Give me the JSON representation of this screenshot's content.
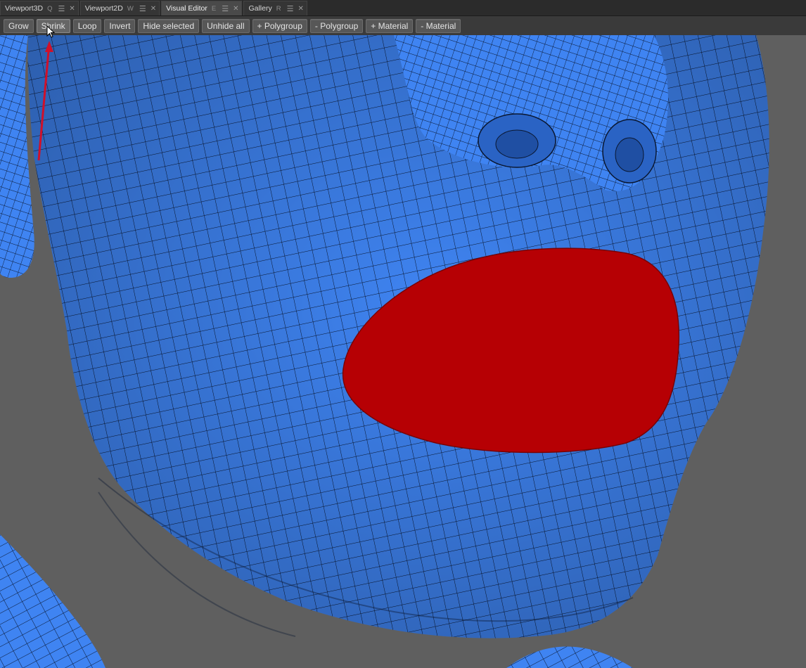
{
  "tabs": [
    {
      "label": "Viewport3D",
      "key": "Q"
    },
    {
      "label": "Viewport2D",
      "key": "W"
    },
    {
      "label": "Visual Editor",
      "key": "E"
    },
    {
      "label": "Gallery",
      "key": "R"
    }
  ],
  "toolbar": {
    "buttons": [
      "Grow",
      "Shrink",
      "Loop",
      "Invert",
      "Hide selected",
      "Unhide all",
      "+ Polygroup",
      "- Polygroup",
      "+ Material",
      "- Material"
    ]
  },
  "colors": {
    "mesh_fill": "#3f84f2",
    "wire": "#0a1730",
    "selection": "#b60004",
    "background": "#5f5f5f",
    "annotation_arrow": "#d0102a"
  },
  "icons": {
    "tab_menu": "hamburger-icon",
    "tab_close": "close-icon",
    "cursor": "mouse-pointer-icon",
    "annotation": "red-arrow-annotation"
  }
}
